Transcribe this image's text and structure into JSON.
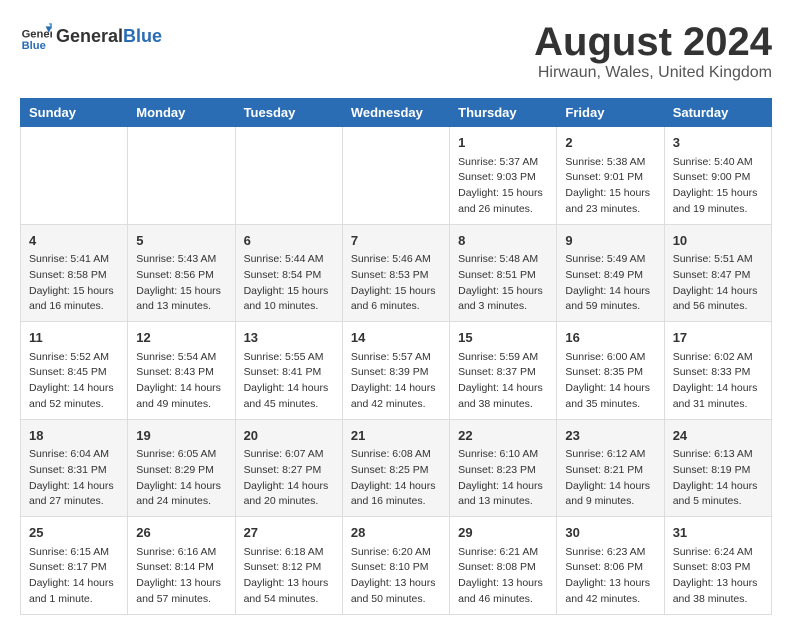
{
  "header": {
    "logo_general": "General",
    "logo_blue": "Blue",
    "main_title": "August 2024",
    "subtitle": "Hirwaun, Wales, United Kingdom"
  },
  "calendar": {
    "days_of_week": [
      "Sunday",
      "Monday",
      "Tuesday",
      "Wednesday",
      "Thursday",
      "Friday",
      "Saturday"
    ],
    "weeks": [
      [
        {
          "day": "",
          "info": ""
        },
        {
          "day": "",
          "info": ""
        },
        {
          "day": "",
          "info": ""
        },
        {
          "day": "",
          "info": ""
        },
        {
          "day": "1",
          "info": "Sunrise: 5:37 AM\nSunset: 9:03 PM\nDaylight: 15 hours\nand 26 minutes."
        },
        {
          "day": "2",
          "info": "Sunrise: 5:38 AM\nSunset: 9:01 PM\nDaylight: 15 hours\nand 23 minutes."
        },
        {
          "day": "3",
          "info": "Sunrise: 5:40 AM\nSunset: 9:00 PM\nDaylight: 15 hours\nand 19 minutes."
        }
      ],
      [
        {
          "day": "4",
          "info": "Sunrise: 5:41 AM\nSunset: 8:58 PM\nDaylight: 15 hours\nand 16 minutes."
        },
        {
          "day": "5",
          "info": "Sunrise: 5:43 AM\nSunset: 8:56 PM\nDaylight: 15 hours\nand 13 minutes."
        },
        {
          "day": "6",
          "info": "Sunrise: 5:44 AM\nSunset: 8:54 PM\nDaylight: 15 hours\nand 10 minutes."
        },
        {
          "day": "7",
          "info": "Sunrise: 5:46 AM\nSunset: 8:53 PM\nDaylight: 15 hours\nand 6 minutes."
        },
        {
          "day": "8",
          "info": "Sunrise: 5:48 AM\nSunset: 8:51 PM\nDaylight: 15 hours\nand 3 minutes."
        },
        {
          "day": "9",
          "info": "Sunrise: 5:49 AM\nSunset: 8:49 PM\nDaylight: 14 hours\nand 59 minutes."
        },
        {
          "day": "10",
          "info": "Sunrise: 5:51 AM\nSunset: 8:47 PM\nDaylight: 14 hours\nand 56 minutes."
        }
      ],
      [
        {
          "day": "11",
          "info": "Sunrise: 5:52 AM\nSunset: 8:45 PM\nDaylight: 14 hours\nand 52 minutes."
        },
        {
          "day": "12",
          "info": "Sunrise: 5:54 AM\nSunset: 8:43 PM\nDaylight: 14 hours\nand 49 minutes."
        },
        {
          "day": "13",
          "info": "Sunrise: 5:55 AM\nSunset: 8:41 PM\nDaylight: 14 hours\nand 45 minutes."
        },
        {
          "day": "14",
          "info": "Sunrise: 5:57 AM\nSunset: 8:39 PM\nDaylight: 14 hours\nand 42 minutes."
        },
        {
          "day": "15",
          "info": "Sunrise: 5:59 AM\nSunset: 8:37 PM\nDaylight: 14 hours\nand 38 minutes."
        },
        {
          "day": "16",
          "info": "Sunrise: 6:00 AM\nSunset: 8:35 PM\nDaylight: 14 hours\nand 35 minutes."
        },
        {
          "day": "17",
          "info": "Sunrise: 6:02 AM\nSunset: 8:33 PM\nDaylight: 14 hours\nand 31 minutes."
        }
      ],
      [
        {
          "day": "18",
          "info": "Sunrise: 6:04 AM\nSunset: 8:31 PM\nDaylight: 14 hours\nand 27 minutes."
        },
        {
          "day": "19",
          "info": "Sunrise: 6:05 AM\nSunset: 8:29 PM\nDaylight: 14 hours\nand 24 minutes."
        },
        {
          "day": "20",
          "info": "Sunrise: 6:07 AM\nSunset: 8:27 PM\nDaylight: 14 hours\nand 20 minutes."
        },
        {
          "day": "21",
          "info": "Sunrise: 6:08 AM\nSunset: 8:25 PM\nDaylight: 14 hours\nand 16 minutes."
        },
        {
          "day": "22",
          "info": "Sunrise: 6:10 AM\nSunset: 8:23 PM\nDaylight: 14 hours\nand 13 minutes."
        },
        {
          "day": "23",
          "info": "Sunrise: 6:12 AM\nSunset: 8:21 PM\nDaylight: 14 hours\nand 9 minutes."
        },
        {
          "day": "24",
          "info": "Sunrise: 6:13 AM\nSunset: 8:19 PM\nDaylight: 14 hours\nand 5 minutes."
        }
      ],
      [
        {
          "day": "25",
          "info": "Sunrise: 6:15 AM\nSunset: 8:17 PM\nDaylight: 14 hours\nand 1 minute."
        },
        {
          "day": "26",
          "info": "Sunrise: 6:16 AM\nSunset: 8:14 PM\nDaylight: 13 hours\nand 57 minutes."
        },
        {
          "day": "27",
          "info": "Sunrise: 6:18 AM\nSunset: 8:12 PM\nDaylight: 13 hours\nand 54 minutes."
        },
        {
          "day": "28",
          "info": "Sunrise: 6:20 AM\nSunset: 8:10 PM\nDaylight: 13 hours\nand 50 minutes."
        },
        {
          "day": "29",
          "info": "Sunrise: 6:21 AM\nSunset: 8:08 PM\nDaylight: 13 hours\nand 46 minutes."
        },
        {
          "day": "30",
          "info": "Sunrise: 6:23 AM\nSunset: 8:06 PM\nDaylight: 13 hours\nand 42 minutes."
        },
        {
          "day": "31",
          "info": "Sunrise: 6:24 AM\nSunset: 8:03 PM\nDaylight: 13 hours\nand 38 minutes."
        }
      ]
    ]
  }
}
